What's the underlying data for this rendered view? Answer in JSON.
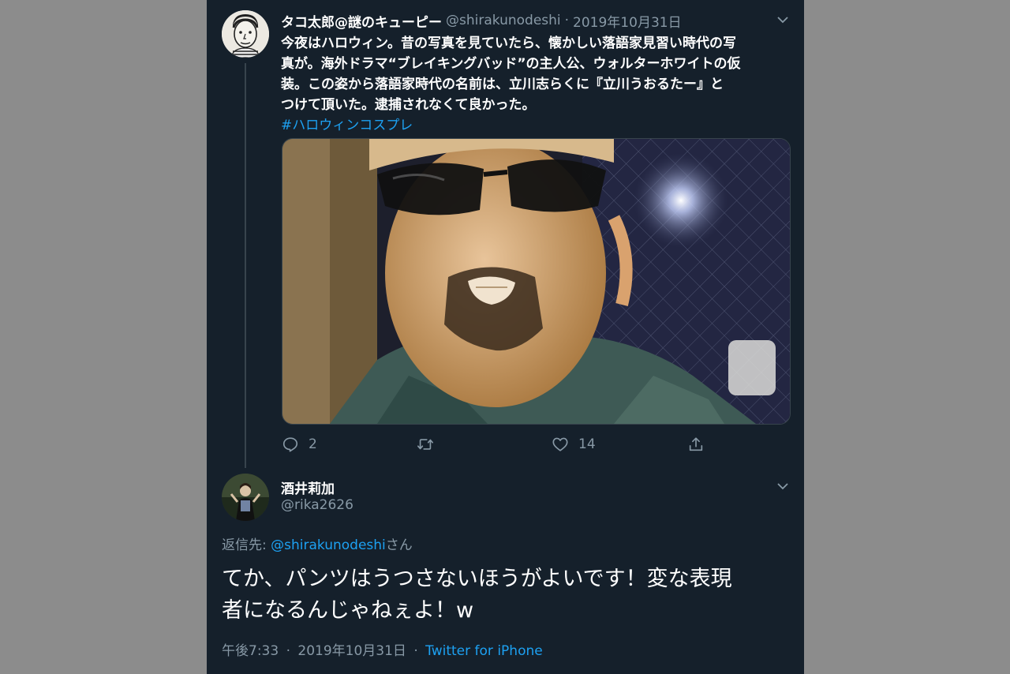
{
  "tweet": {
    "author_name": "タコ太郎@謎のキューピー",
    "author_handle": "@shirakunodeshi",
    "separator": "·",
    "date": "2019年10月31日",
    "text_lines": [
      "今夜はハロウィン。昔の写真を見ていたら、懐かしい落語家見習い時代の写",
      "真が。海外ドラマ“ブレイキングバッド”の主人公、ウォルターホワイトの仮",
      "装。この姿から落語家時代の名前は、立川志らくに『立川うおるたー』と",
      "つけて頂いた。逮捕されなくて良かった。"
    ],
    "hashtag": "#ハロウィンコスプレ",
    "reply_count": "2",
    "like_count": "14"
  },
  "reply": {
    "author_name": "酒井莉加",
    "author_handle": "@rika2626",
    "reply_to_prefix": "返信先: ",
    "reply_to_handle": "@shirakunodeshi",
    "reply_to_suffix": "さん",
    "text_lines": [
      "てか、パンツはうつさないほうがよいです！変な表現",
      "者になるんじゃねぇよ！w"
    ],
    "time": "午後7:33",
    "separator": "·",
    "date": "2019年10月31日",
    "source_separator": "·",
    "source": "Twitter for iPhone"
  },
  "colors": {
    "background": "#15202b",
    "text": "#ffffff",
    "secondary": "#8899a6",
    "link": "#1da1f2",
    "outer": "#8c8c8c"
  },
  "icons": [
    "chevron-down-icon",
    "reply-icon",
    "retweet-icon",
    "like-icon",
    "share-icon"
  ]
}
